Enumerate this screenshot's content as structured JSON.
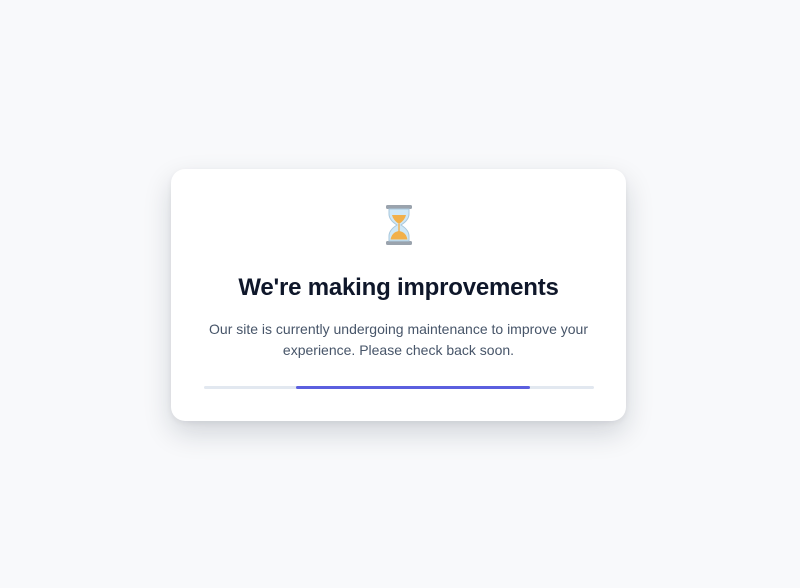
{
  "card": {
    "icon": "hourglass-icon",
    "title": "We're making improvements",
    "message": "Our site is currently undergoing maintenance to improve your experience. Please check back soon."
  },
  "progress": {
    "indicator_start": 0.235,
    "indicator_end": 0.835,
    "track_color": "#e2e8f0",
    "fill_color": "#5b5fdf"
  },
  "colors": {
    "background": "#f8f9fb",
    "card": "#ffffff",
    "title": "#0f172a",
    "message": "#475569"
  }
}
